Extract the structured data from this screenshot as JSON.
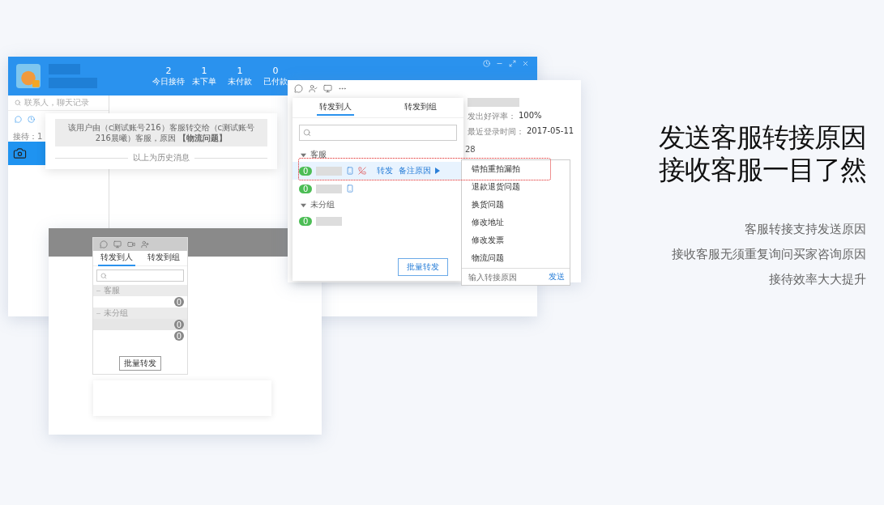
{
  "back_window": {
    "stats": [
      {
        "value": "2",
        "label": "今日接待"
      },
      {
        "value": "1",
        "label": "未下单"
      },
      {
        "value": "1",
        "label": "未付款"
      },
      {
        "value": "0",
        "label": "已付款"
      }
    ],
    "search": {
      "placeholder": "联系人，聊天记录"
    },
    "reception_count": "接待：1",
    "transfer_notice": "该用户由（c测试账号216）客服转交给（c测试账号216晨曦）客服，原因 **【物流问题】**",
    "history_divider": "以上为历史消息"
  },
  "profile": {
    "rows": [
      {
        "label": "发出好评率：",
        "value": "100%"
      },
      {
        "label": "最近登录时间：",
        "value": "2017-05-11"
      }
    ],
    "partial_date": "28"
  },
  "transfer_panel": {
    "tabs": [
      {
        "label": "转发到人",
        "selected": true
      },
      {
        "label": "转发到组",
        "selected": false
      }
    ],
    "groups": [
      {
        "name": "客服",
        "expanded": true,
        "members": [
          {
            "count": "0",
            "highlighted": true,
            "actions": [
              "转发",
              "备注原因"
            ]
          },
          {
            "count": "0",
            "highlighted": false
          }
        ]
      },
      {
        "name": "未分组",
        "expanded": true,
        "members": [
          {
            "count": "0",
            "highlighted": false
          }
        ]
      }
    ],
    "batch_button": "批量转发"
  },
  "reasons_menu": {
    "items": [
      "错拍重拍漏拍",
      "退款退货问题",
      "换货问题",
      "修改地址",
      "修改发票",
      "物流问题"
    ],
    "input": {
      "placeholder": "输入转接原因"
    },
    "send_button": "发送"
  },
  "small_window": {
    "tabs": [
      {
        "label": "转发到人",
        "selected": true
      },
      {
        "label": "转发到组",
        "selected": false
      }
    ],
    "groups": [
      {
        "name": "客服",
        "counts": [
          "0"
        ]
      },
      {
        "name": "未分组",
        "counts": [
          "0",
          "0"
        ]
      }
    ],
    "batch_button": "批量转发"
  },
  "headline": [
    "发送客服转接原因",
    "接收客服一目了然"
  ],
  "features": [
    "客服转接支持发送原因",
    "接收客服无须重复询问买家咨询原因",
    "接待效率大大提升"
  ]
}
